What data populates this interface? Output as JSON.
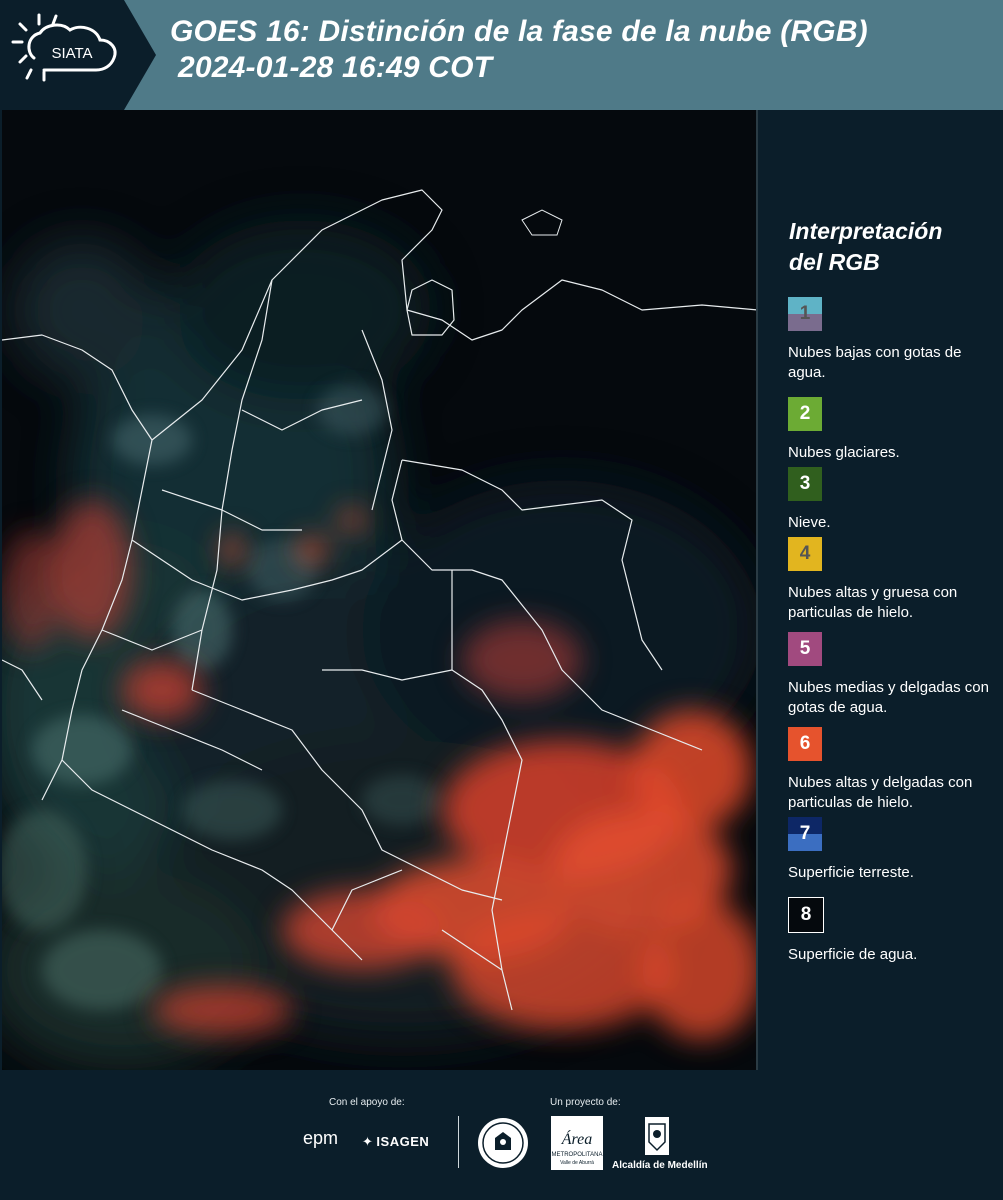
{
  "header": {
    "logo_text": "SIATA",
    "title_line1": "GOES 16: Distinción de la fase de la nube (RGB)",
    "title_line2": "2024-01-28 16:49 COT"
  },
  "legend": {
    "title_line1": "Interpretación",
    "title_line2": "del RGB",
    "items": [
      {
        "number": "1",
        "label": "Nubes bajas con gotas de agua.",
        "color_top": "#5fb3c6",
        "color_bottom": "#7a6c8e",
        "number_color": "#555555"
      },
      {
        "number": "2",
        "label": "Nubes glaciares.",
        "color_top": "#6cab34",
        "color_bottom": "#6cab34",
        "number_color": "#ffffff"
      },
      {
        "number": "3",
        "label": "Nieve.",
        "color_top": "#305f1e",
        "color_bottom": "#305f1e",
        "number_color": "#ffffff"
      },
      {
        "number": "4",
        "label": "Nubes altas y gruesa con particulas de hielo.",
        "color_top": "#e2b51f",
        "color_bottom": "#e2b51f",
        "number_color": "#555555"
      },
      {
        "number": "5",
        "label": "Nubes medias y delgadas con gotas de agua.",
        "color_top": "#a14a7f",
        "color_bottom": "#a14a7f",
        "number_color": "#ffffff"
      },
      {
        "number": "6",
        "label": "Nubes altas y delgadas con particulas de hielo.",
        "color_top": "#e6532d",
        "color_bottom": "#e6532d",
        "number_color": "#ffffff"
      },
      {
        "number": "7",
        "label": "Superficie terreste.",
        "color_top": "#0d2766",
        "color_bottom": "#3b6ec1",
        "number_color": "#ffffff"
      },
      {
        "number": "8",
        "label": "Superficie de agua.",
        "color_top": "#05090d",
        "color_bottom": "#05090d",
        "number_color": "#ffffff"
      }
    ]
  },
  "footer": {
    "support_label": "Con el apoyo de:",
    "project_label": "Un proyecto de:",
    "sponsor_epm": "epm",
    "sponsor_isagen": "ISAGEN",
    "area_logo_text": "Área",
    "area_caption_1": "METROPOLITANA",
    "area_caption_2": "Valle de Aburrá",
    "alcaldia_label": "Alcaldía de Medellín"
  },
  "colors": {
    "header_bg": "#4f7a88",
    "page_bg": "#0b1e2a",
    "cloud_high_thin_ice": "#f04a2a"
  }
}
